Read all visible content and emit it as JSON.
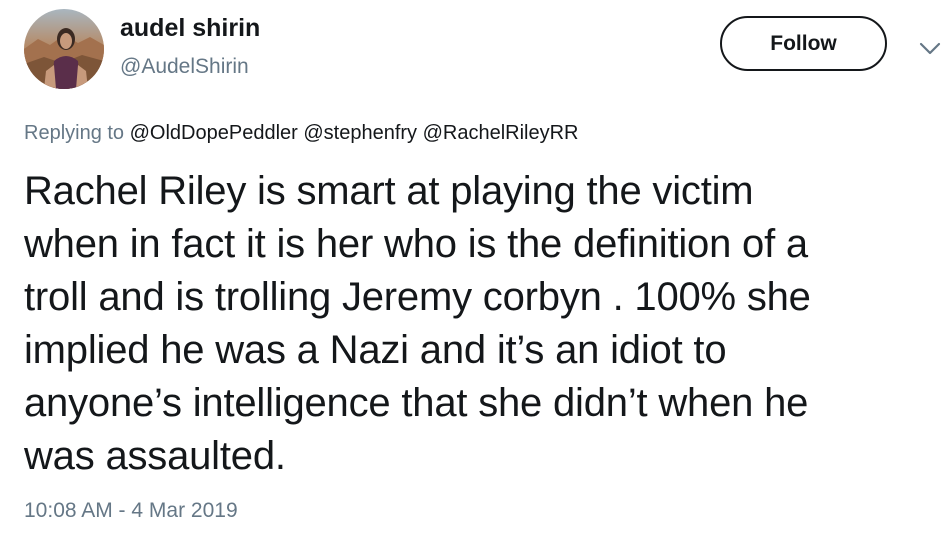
{
  "tweet": {
    "display_name": "audel shirin",
    "screen_name": "@AudelShirin",
    "follow_label": "Follow",
    "replying_prefix": "Replying to",
    "replying_to": "@OldDopePeddler @stephenfry @RachelRileyRR",
    "text": "Rachel Riley is smart at playing the victim\nwhen in fact it is her who is the definition of a\ntroll and is trolling Jeremy corbyn . 100% she\nimplied he was a Nazi and it’s an idiot to\nanyone’s intelligence that she didn’t when he\nwas assaulted.",
    "timestamp": "10:08 AM - 4 Mar 2019"
  },
  "icons": {
    "avatar": "avatar-photo",
    "caret": "chevron-down-icon"
  },
  "colors": {
    "text_primary": "#14171a",
    "text_secondary": "#657786",
    "follow_border": "#14171a"
  }
}
